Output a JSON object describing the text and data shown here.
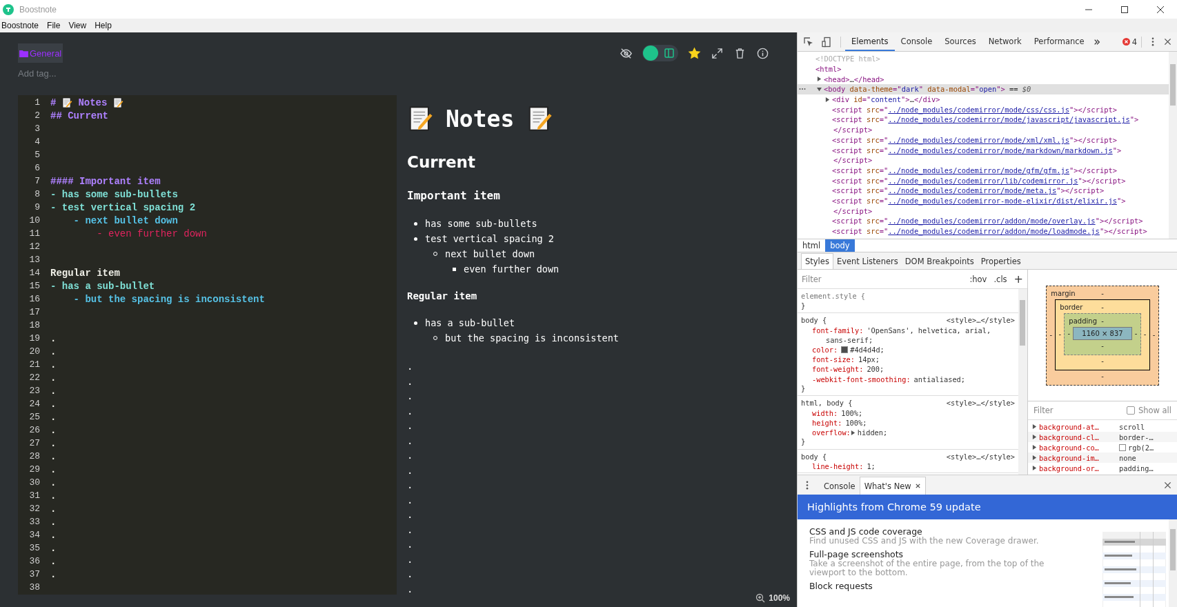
{
  "window": {
    "title": "Boostnote"
  },
  "menu": [
    {
      "label": "Boostnote"
    },
    {
      "label": "File"
    },
    {
      "label": "View"
    },
    {
      "label": "Help"
    }
  ],
  "note": {
    "folder": "General",
    "tag_placeholder": "Add tag...",
    "starred": true,
    "view_toggle": {
      "on": true
    }
  },
  "editor": {
    "lines": [
      {
        "number": "1",
        "kind": "title",
        "text": "#",
        "title": "Notes"
      },
      {
        "number": "2",
        "kind": "heading",
        "text": "## Current"
      },
      {
        "number": "3",
        "kind": "blank"
      },
      {
        "number": "4",
        "kind": "blank"
      },
      {
        "number": "5",
        "kind": "blank"
      },
      {
        "number": "6",
        "kind": "blank"
      },
      {
        "number": "7",
        "kind": "heading",
        "text": "#### Important item"
      },
      {
        "number": "8",
        "kind": "bullet",
        "text": "- has some sub-bullets"
      },
      {
        "number": "9",
        "kind": "bullet",
        "text": "- test vertical spacing 2"
      },
      {
        "number": "10",
        "kind": "bullet-2",
        "text": "    - next bullet down"
      },
      {
        "number": "11",
        "kind": "bullet-3",
        "text": "        - even further down"
      },
      {
        "number": "12",
        "kind": "blank"
      },
      {
        "number": "13",
        "kind": "blank"
      },
      {
        "number": "14",
        "kind": "text",
        "text": "Regular item"
      },
      {
        "number": "15",
        "kind": "bullet",
        "text": "- has a sub-bullet"
      },
      {
        "number": "16",
        "kind": "bullet-2",
        "text": "    - but the spacing is inconsistent"
      },
      {
        "number": "17",
        "kind": "blank"
      },
      {
        "number": "18",
        "kind": "blank"
      },
      {
        "number": "19",
        "kind": "text",
        "text": "."
      },
      {
        "number": "20",
        "kind": "text",
        "text": "."
      },
      {
        "number": "21",
        "kind": "text",
        "text": "."
      },
      {
        "number": "22",
        "kind": "text",
        "text": "."
      },
      {
        "number": "23",
        "kind": "text",
        "text": "."
      },
      {
        "number": "24",
        "kind": "text",
        "text": "."
      },
      {
        "number": "25",
        "kind": "text",
        "text": "."
      },
      {
        "number": "26",
        "kind": "text",
        "text": "."
      },
      {
        "number": "27",
        "kind": "text",
        "text": "."
      },
      {
        "number": "28",
        "kind": "text",
        "text": "."
      },
      {
        "number": "29",
        "kind": "text",
        "text": "."
      },
      {
        "number": "30",
        "kind": "text",
        "text": "."
      },
      {
        "number": "31",
        "kind": "text",
        "text": "."
      },
      {
        "number": "32",
        "kind": "text",
        "text": "."
      },
      {
        "number": "33",
        "kind": "text",
        "text": "."
      },
      {
        "number": "34",
        "kind": "text",
        "text": "."
      },
      {
        "number": "35",
        "kind": "text",
        "text": "."
      },
      {
        "number": "36",
        "kind": "text",
        "text": "."
      },
      {
        "number": "37",
        "kind": "text",
        "text": "."
      },
      {
        "number": "38",
        "kind": "blank"
      }
    ]
  },
  "preview": {
    "title": "Notes",
    "blocks": [
      {
        "kind": "h2",
        "text": "Current"
      },
      {
        "kind": "h4",
        "text": "Important item"
      },
      {
        "kind": "list",
        "items": [
          {
            "text": "has some sub-bullets"
          },
          {
            "text": "test vertical spacing 2",
            "children": [
              {
                "text": "next bullet down",
                "children": [
                  {
                    "text": "even further down"
                  }
                ]
              }
            ]
          }
        ]
      },
      {
        "kind": "p",
        "text": "Regular item"
      },
      {
        "kind": "list",
        "items": [
          {
            "text": "has a sub-bullet",
            "children": [
              {
                "text": "but the spacing is inconsistent"
              }
            ]
          }
        ]
      },
      {
        "kind": "dots",
        "items": [
          ".",
          ".",
          ".",
          ".",
          ".",
          ".",
          ".",
          ".",
          ".",
          ".",
          ".",
          ".",
          ".",
          ".",
          ".",
          "."
        ]
      }
    ]
  },
  "zoom": "100%",
  "devtools": {
    "tabs": [
      {
        "label": "Elements",
        "selected": true
      },
      {
        "label": "Console",
        "selected": false
      },
      {
        "label": "Sources",
        "selected": false
      },
      {
        "label": "Network",
        "selected": false
      },
      {
        "label": "Performance",
        "selected": false
      }
    ],
    "error_count": "4",
    "dom": [
      {
        "selected": false,
        "parts": [
          {
            "kind": "dim",
            "text": "<!DOCTYPE html>"
          }
        ]
      },
      {
        "selected": false,
        "parts": [
          {
            "kind": "tag",
            "text": "<html>"
          }
        ],
        "children": [
          {
            "selected": false,
            "expanded": false,
            "parts": [
              {
                "kind": "tag",
                "text": "<head>"
              },
              {
                "kind": "plain",
                "text": "…"
              },
              {
                "kind": "tag",
                "text": "</head>"
              }
            ]
          },
          {
            "selected": true,
            "expanded": true,
            "parts": [
              {
                "kind": "tag",
                "text": "<body "
              },
              {
                "kind": "attr",
                "text": "data-theme"
              },
              {
                "kind": "tag",
                "text": "=\""
              },
              {
                "kind": "val",
                "text": "dark"
              },
              {
                "kind": "tag",
                "text": "\" "
              },
              {
                "kind": "attr",
                "text": "data-modal"
              },
              {
                "kind": "tag",
                "text": "=\""
              },
              {
                "kind": "val",
                "text": "open"
              },
              {
                "kind": "tag",
                "text": "\">"
              },
              {
                "kind": "plain",
                "text": " == "
              },
              {
                "kind": "var",
                "text": "$0"
              }
            ],
            "children": [
              {
                "selected": false,
                "expanded": false,
                "parts": [
                  {
                    "kind": "tag",
                    "text": "<div "
                  },
                  {
                    "kind": "attr",
                    "text": "id"
                  },
                  {
                    "kind": "tag",
                    "text": "=\""
                  },
                  {
                    "kind": "val",
                    "text": "content"
                  },
                  {
                    "kind": "tag",
                    "text": "\">"
                  },
                  {
                    "kind": "plain",
                    "text": "…"
                  },
                  {
                    "kind": "tag",
                    "text": "</div>"
                  }
                ]
              },
              {
                "selected": false,
                "parts": [
                  {
                    "kind": "tag",
                    "text": "<script "
                  },
                  {
                    "kind": "attr",
                    "text": "src"
                  },
                  {
                    "kind": "tag",
                    "text": "=\""
                  },
                  {
                    "kind": "link",
                    "text": "../node_modules/codemirror/mode/css/css.js"
                  },
                  {
                    "kind": "tag",
                    "text": "\"></script>"
                  }
                ]
              },
              {
                "selected": false,
                "parts": [
                  {
                    "kind": "tag",
                    "text": "<script "
                  },
                  {
                    "kind": "attr",
                    "text": "src"
                  },
                  {
                    "kind": "tag",
                    "text": "=\""
                  },
                  {
                    "kind": "link",
                    "text": "../node_modules/codemirror/mode/javascript/javascript.js"
                  },
                  {
                    "kind": "tag",
                    "text": "\">"
                  }
                ],
                "tail": [
                  {
                    "kind": "tag",
                    "text": "</script>"
                  }
                ]
              },
              {
                "selected": false,
                "parts": [
                  {
                    "kind": "tag",
                    "text": "<script "
                  },
                  {
                    "kind": "attr",
                    "text": "src"
                  },
                  {
                    "kind": "tag",
                    "text": "=\""
                  },
                  {
                    "kind": "link",
                    "text": "../node_modules/codemirror/mode/xml/xml.js"
                  },
                  {
                    "kind": "tag",
                    "text": "\"></script>"
                  }
                ]
              },
              {
                "selected": false,
                "parts": [
                  {
                    "kind": "tag",
                    "text": "<script "
                  },
                  {
                    "kind": "attr",
                    "text": "src"
                  },
                  {
                    "kind": "tag",
                    "text": "=\""
                  },
                  {
                    "kind": "link",
                    "text": "../node_modules/codemirror/mode/markdown/markdown.js"
                  },
                  {
                    "kind": "tag",
                    "text": "\">"
                  }
                ],
                "tail": [
                  {
                    "kind": "tag",
                    "text": "</script>"
                  }
                ]
              },
              {
                "selected": false,
                "parts": [
                  {
                    "kind": "tag",
                    "text": "<script "
                  },
                  {
                    "kind": "attr",
                    "text": "src"
                  },
                  {
                    "kind": "tag",
                    "text": "=\""
                  },
                  {
                    "kind": "link",
                    "text": "../node_modules/codemirror/mode/gfm/gfm.js"
                  },
                  {
                    "kind": "tag",
                    "text": "\"></script>"
                  }
                ]
              },
              {
                "selected": false,
                "parts": [
                  {
                    "kind": "tag",
                    "text": "<script "
                  },
                  {
                    "kind": "attr",
                    "text": "src"
                  },
                  {
                    "kind": "tag",
                    "text": "=\""
                  },
                  {
                    "kind": "link",
                    "text": "../node_modules/codemirror/lib/codemirror.js"
                  },
                  {
                    "kind": "tag",
                    "text": "\"></script>"
                  }
                ]
              },
              {
                "selected": false,
                "parts": [
                  {
                    "kind": "tag",
                    "text": "<script "
                  },
                  {
                    "kind": "attr",
                    "text": "src"
                  },
                  {
                    "kind": "tag",
                    "text": "=\""
                  },
                  {
                    "kind": "link",
                    "text": "../node_modules/codemirror/mode/meta.js"
                  },
                  {
                    "kind": "tag",
                    "text": "\"></script>"
                  }
                ]
              },
              {
                "selected": false,
                "parts": [
                  {
                    "kind": "tag",
                    "text": "<script "
                  },
                  {
                    "kind": "attr",
                    "text": "src"
                  },
                  {
                    "kind": "tag",
                    "text": "=\""
                  },
                  {
                    "kind": "link",
                    "text": "../node_modules/codemirror-mode-elixir/dist/elixir.js"
                  },
                  {
                    "kind": "tag",
                    "text": "\">"
                  }
                ],
                "tail": [
                  {
                    "kind": "tag",
                    "text": "</script>"
                  }
                ]
              },
              {
                "selected": false,
                "parts": [
                  {
                    "kind": "tag",
                    "text": "<script "
                  },
                  {
                    "kind": "attr",
                    "text": "src"
                  },
                  {
                    "kind": "tag",
                    "text": "=\""
                  },
                  {
                    "kind": "link",
                    "text": "../node_modules/codemirror/addon/mode/overlay.js"
                  },
                  {
                    "kind": "tag",
                    "text": "\"></script>"
                  }
                ]
              },
              {
                "selected": false,
                "parts": [
                  {
                    "kind": "tag",
                    "text": "<script "
                  },
                  {
                    "kind": "attr",
                    "text": "src"
                  },
                  {
                    "kind": "tag",
                    "text": "=\""
                  },
                  {
                    "kind": "link",
                    "text": "../node_modules/codemirror/addon/mode/loadmode.js"
                  },
                  {
                    "kind": "tag",
                    "text": "\"></script>"
                  }
                ]
              }
            ]
          }
        ]
      }
    ],
    "breadcrumb": [
      {
        "label": "html",
        "selected": false
      },
      {
        "label": "body",
        "selected": true
      }
    ],
    "side_tabs": [
      {
        "label": "Styles",
        "selected": true
      },
      {
        "label": "Event Listeners",
        "selected": false
      },
      {
        "label": "DOM Breakpoints",
        "selected": false
      },
      {
        "label": "Properties",
        "selected": false
      }
    ],
    "styles": {
      "filter_placeholder": "Filter",
      "hov": ":hov",
      "cls": ".cls",
      "add": "+",
      "rules": [
        {
          "selector": "element.style {",
          "dim": true,
          "close": "}"
        },
        {
          "selector": "body {",
          "dim": false,
          "source": "<style>…</style>",
          "props": [
            {
              "name": "font-family:",
              "value": "'OpenSans', helvetica, arial,",
              "cont": "sans-serif;",
              "expandable": false
            },
            {
              "name": "color:",
              "value": "#4d4d4d;",
              "swatch": true,
              "expandable": false
            },
            {
              "name": "font-size:",
              "value": "14px;",
              "expandable": false
            },
            {
              "name": "font-weight:",
              "value": "200;",
              "expandable": false
            },
            {
              "name": "-webkit-font-smoothing:",
              "value": "antialiased;",
              "expandable": false
            }
          ],
          "close": "}"
        },
        {
          "selector": "html, body {",
          "dim": false,
          "source": "<style>…</style>",
          "props": [
            {
              "name": "width:",
              "value": "100%;",
              "expandable": false
            },
            {
              "name": "height:",
              "value": "100%;",
              "expandable": false
            },
            {
              "name": "overflow:",
              "value": "hidden;",
              "expandable": true
            }
          ],
          "close": "}"
        },
        {
          "selector": "body {",
          "dim": false,
          "source": "<style>…</style>",
          "props": [
            {
              "name": "line-height:",
              "value": "1;",
              "expandable": false
            }
          ]
        }
      ]
    },
    "box_model": {
      "margin": {
        "label": "margin",
        "top": "-",
        "right": "-",
        "bottom": "-",
        "left": "-"
      },
      "border": {
        "label": "border",
        "top": "-",
        "right": "-",
        "bottom": "-",
        "left": "-"
      },
      "padding": {
        "label": "padding",
        "top": "-",
        "right": "-",
        "bottom": "-",
        "left": "-"
      },
      "content": "1160 × 837"
    },
    "computed": {
      "filter_placeholder": "Filter",
      "show_all": {
        "label": "Show all",
        "checked": false
      },
      "props": [
        {
          "name": "background-at…",
          "value": "scroll"
        },
        {
          "name": "background-cl…",
          "value": "border-…"
        },
        {
          "name": "background-co…",
          "value": "rgb(2…",
          "swatch": true
        },
        {
          "name": "background-im…",
          "value": "none"
        },
        {
          "name": "background-or…",
          "value": "padding…"
        }
      ]
    },
    "drawer": {
      "tabs": [
        {
          "label": "Console",
          "selected": false,
          "closable": false
        },
        {
          "label": "What's New",
          "selected": true,
          "closable": true
        }
      ],
      "header": "Highlights from Chrome 59 update",
      "items": [
        {
          "title": "CSS and JS code coverage",
          "desc": "Find unused CSS and JS with the new Coverage drawer."
        },
        {
          "title": "Full-page screenshots",
          "desc": "Take a screenshot of the entire page, from the top of the viewport to the bottom."
        },
        {
          "title": "Block requests"
        }
      ]
    }
  }
}
